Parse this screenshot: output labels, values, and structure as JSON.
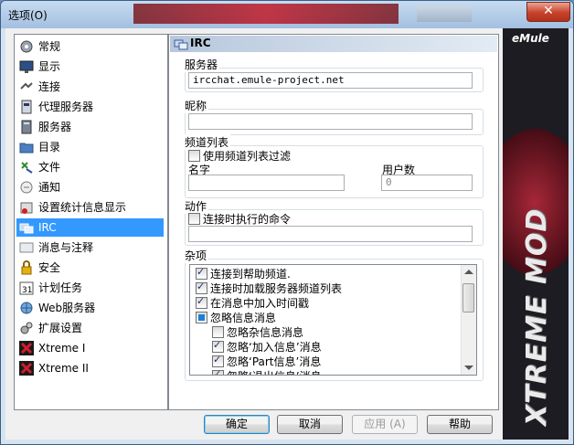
{
  "window": {
    "title": "选项(O)",
    "close_label": "✕"
  },
  "nav": {
    "items": [
      {
        "label": "常规",
        "icon": "general-icon"
      },
      {
        "label": "显示",
        "icon": "monitor-icon"
      },
      {
        "label": "连接",
        "icon": "connection-icon"
      },
      {
        "label": "代理服务器",
        "icon": "proxy-icon"
      },
      {
        "label": "服务器",
        "icon": "server-icon"
      },
      {
        "label": "目录",
        "icon": "folder-icon"
      },
      {
        "label": "文件",
        "icon": "file-icon"
      },
      {
        "label": "通知",
        "icon": "notify-icon"
      },
      {
        "label": "设置统计信息显示",
        "icon": "stats-icon"
      },
      {
        "label": "IRC",
        "icon": "irc-icon",
        "selected": true
      },
      {
        "label": "消息与注释",
        "icon": "message-icon"
      },
      {
        "label": "安全",
        "icon": "lock-icon"
      },
      {
        "label": "计划任务",
        "icon": "calendar-icon"
      },
      {
        "label": "Web服务器",
        "icon": "web-icon"
      },
      {
        "label": "扩展设置",
        "icon": "extended-icon"
      },
      {
        "label": "Xtreme I",
        "icon": "xtreme-icon"
      },
      {
        "label": "Xtreme II",
        "icon": "xtreme-icon"
      }
    ]
  },
  "panel": {
    "title": "IRC",
    "server": {
      "label": "服务器",
      "value": "ircchat.emule-project.net"
    },
    "nick": {
      "label": "昵称",
      "value": ""
    },
    "channel": {
      "label": "频道列表",
      "filter_label": "使用频道列表过滤",
      "filter_checked": false,
      "name_label": "名字",
      "name_value": "",
      "users_label": "用户数",
      "users_value": "0"
    },
    "action": {
      "label": "动作",
      "perform_label": "连接时执行的命令",
      "perform_checked": false,
      "perform_value": ""
    },
    "misc": {
      "label": "杂项",
      "items": [
        {
          "label": "连接到帮助频道.",
          "state": "checked",
          "indent": 0
        },
        {
          "label": "连接时加载服务器频道列表",
          "state": "checked",
          "indent": 0
        },
        {
          "label": "在消息中加入时间戳",
          "state": "checked",
          "indent": 0
        },
        {
          "label": "忽略信息消息",
          "state": "partial",
          "indent": 0
        },
        {
          "label": "忽略杂信息消息",
          "state": "unchecked",
          "indent": 1
        },
        {
          "label": "忽略‘加入信息’消息",
          "state": "checked",
          "indent": 1
        },
        {
          "label": "忽略‘Part信息’消息",
          "state": "checked",
          "indent": 1
        },
        {
          "label": "忽略‘退出信息’消息",
          "state": "checked",
          "indent": 1
        }
      ]
    }
  },
  "buttons": {
    "ok": "确定",
    "cancel": "取消",
    "apply": "应用 (A)",
    "help": "帮助"
  },
  "banner": {
    "logo": "eMule",
    "text": "XTREME MOD"
  }
}
